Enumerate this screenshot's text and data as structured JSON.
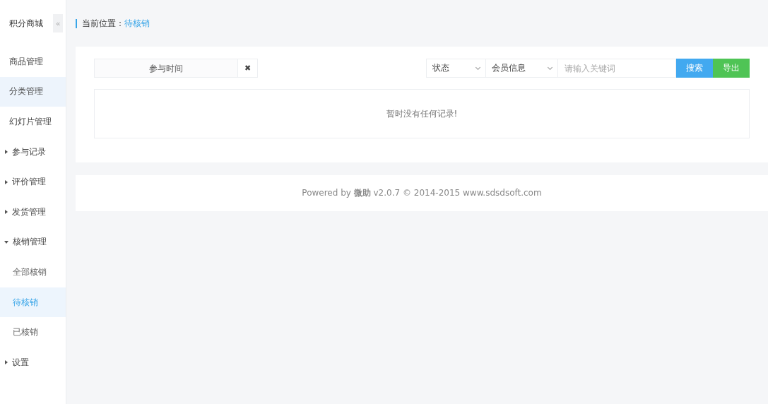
{
  "sidebar": {
    "title": "积分商城",
    "collapse_button": "«",
    "items": [
      {
        "label": "商品管理",
        "kind": "link",
        "selected": false,
        "hover": false
      },
      {
        "label": "分类管理",
        "kind": "link",
        "selected": false,
        "hover": true
      },
      {
        "label": "幻灯片管理",
        "kind": "link",
        "selected": false,
        "hover": false
      },
      {
        "label": "参与记录",
        "kind": "group",
        "expanded": false,
        "selected": false,
        "hover": false
      },
      {
        "label": "评价管理",
        "kind": "group",
        "expanded": false,
        "selected": false,
        "hover": false
      },
      {
        "label": "发货管理",
        "kind": "group",
        "expanded": false,
        "selected": false,
        "hover": false
      },
      {
        "label": "核销管理",
        "kind": "group",
        "expanded": true,
        "selected": false,
        "hover": false,
        "children": [
          {
            "label": "全部核销",
            "selected": false
          },
          {
            "label": "待核销",
            "selected": true
          },
          {
            "label": "已核销",
            "selected": false
          }
        ]
      },
      {
        "label": "设置",
        "kind": "group",
        "expanded": false,
        "selected": false,
        "hover": false
      }
    ]
  },
  "breadcrumb": {
    "label": "当前位置：",
    "current": "待核销"
  },
  "filters": {
    "date": {
      "placeholder": "参与时间",
      "clear": "✖"
    },
    "selects": [
      {
        "value": "状态"
      },
      {
        "value": "会员信息"
      }
    ],
    "keyword": {
      "placeholder": "请输入关键词"
    },
    "buttons": [
      {
        "label": "搜索",
        "kind": "search"
      },
      {
        "label": "导出",
        "kind": "export"
      }
    ]
  },
  "empty_message": "暂时没有任何记录!",
  "footer": "Powered by **微助** v2.0.7 © 2014-2015 www.sdsdsoft.com"
}
